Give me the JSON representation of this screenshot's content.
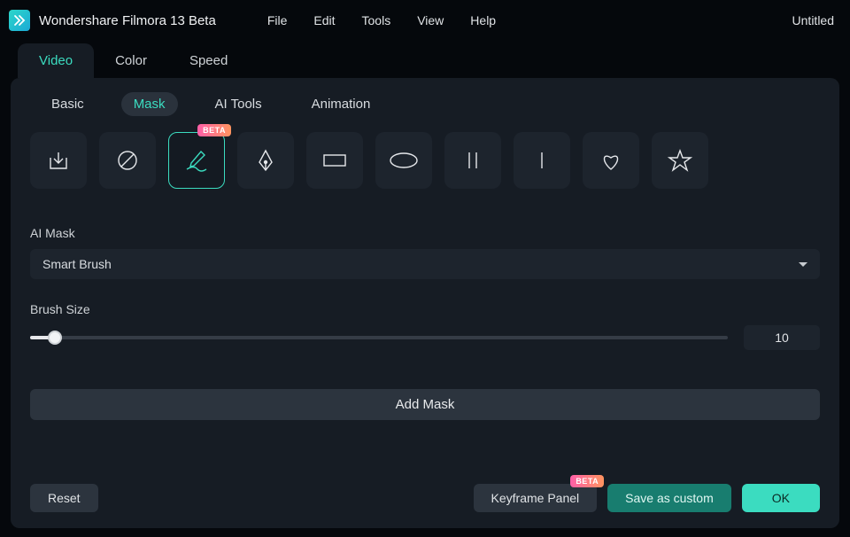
{
  "app": {
    "title": "Wondershare Filmora 13 Beta",
    "doc": "Untitled"
  },
  "menu": [
    "File",
    "Edit",
    "Tools",
    "View",
    "Help"
  ],
  "top_tabs": [
    "Video",
    "Color",
    "Speed"
  ],
  "top_tab_active": 0,
  "sub_tabs": [
    "Basic",
    "Mask",
    "AI Tools",
    "Animation"
  ],
  "sub_tab_active": 1,
  "shapes": {
    "beta_badge": "BETA",
    "items": [
      "import",
      "none",
      "brush",
      "pen",
      "rectangle",
      "ellipse",
      "double-line",
      "single-line",
      "heart",
      "star"
    ],
    "active": 2
  },
  "ai_mask": {
    "label": "AI Mask",
    "value": "Smart Brush"
  },
  "brush": {
    "label": "Brush Size",
    "value": "10"
  },
  "add_mask": "Add Mask",
  "buttons": {
    "reset": "Reset",
    "keyframe": "Keyframe Panel",
    "keyframe_badge": "BETA",
    "save": "Save as custom",
    "ok": "OK"
  }
}
